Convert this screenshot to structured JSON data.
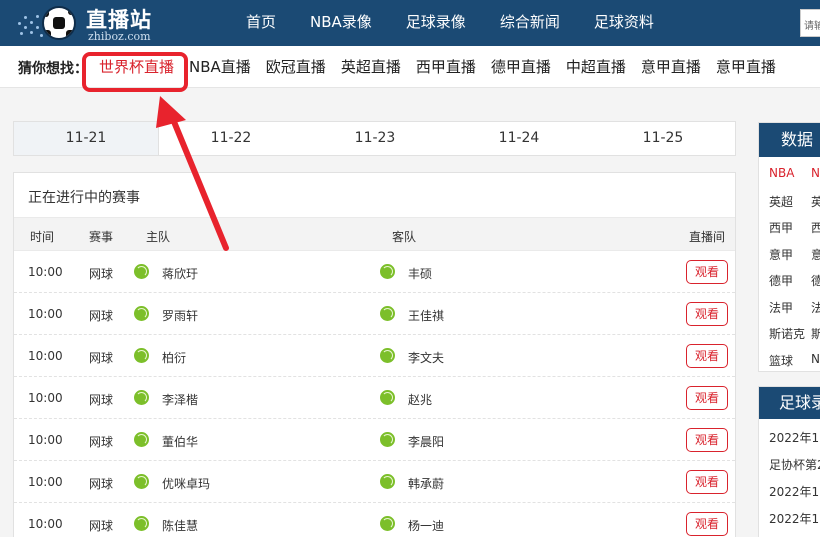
{
  "header": {
    "logo_text": "直播站",
    "logo_sub": "zhiboz.com",
    "nav": [
      "首页",
      "NBA录像",
      "足球录像",
      "综合新闻",
      "足球资料"
    ],
    "search_placeholder": "请输"
  },
  "guess": {
    "label": "猜你想找：",
    "links": [
      "世界杯直播",
      "NBA直播",
      "欧冠直播",
      "英超直播",
      "西甲直播",
      "德甲直播",
      "中超直播",
      "意甲直播",
      "意甲直播"
    ]
  },
  "dates": [
    "11-21",
    "11-22",
    "11-23",
    "11-24",
    "11-25"
  ],
  "matches": {
    "title": "正在进行中的赛事",
    "columns": {
      "time": "时间",
      "event": "赛事",
      "home": "主队",
      "away": "客队",
      "live": "直播间"
    },
    "watch_label": "观看",
    "rows": [
      {
        "time": "10:00",
        "event": "网球",
        "home": "蒋欣玗",
        "away": "丰硕"
      },
      {
        "time": "10:00",
        "event": "网球",
        "home": "罗雨轩",
        "away": "王佳祺"
      },
      {
        "time": "10:00",
        "event": "网球",
        "home": "柏衍",
        "away": "李文夫"
      },
      {
        "time": "10:00",
        "event": "网球",
        "home": "李泽楷",
        "away": "赵兆"
      },
      {
        "time": "10:00",
        "event": "网球",
        "home": "董伯华",
        "away": "李晨阳"
      },
      {
        "time": "10:00",
        "event": "网球",
        "home": "优咪卓玛",
        "away": "韩承蔚"
      },
      {
        "time": "10:00",
        "event": "网球",
        "home": "陈佳慧",
        "away": "杨一迪"
      }
    ]
  },
  "sidebar": {
    "data_title": "数据",
    "data_rows": [
      {
        "a": "NBA",
        "b": "N"
      },
      {
        "a": "英超",
        "b": "英"
      },
      {
        "a": "西甲",
        "b": "西"
      },
      {
        "a": "意甲",
        "b": "意"
      },
      {
        "a": "德甲",
        "b": "德"
      },
      {
        "a": "法甲",
        "b": "法"
      },
      {
        "a": "斯诺克",
        "b": "斯"
      },
      {
        "a": "篮球",
        "b": "N"
      }
    ],
    "video_title": "足球录",
    "video_items": [
      "2022年11",
      "足协杯第2",
      "2022年11",
      "2022年11"
    ]
  },
  "colors": {
    "brand": "#1b4a74",
    "accent": "#d9232d",
    "tennis_ball": "#7cbf2a"
  }
}
